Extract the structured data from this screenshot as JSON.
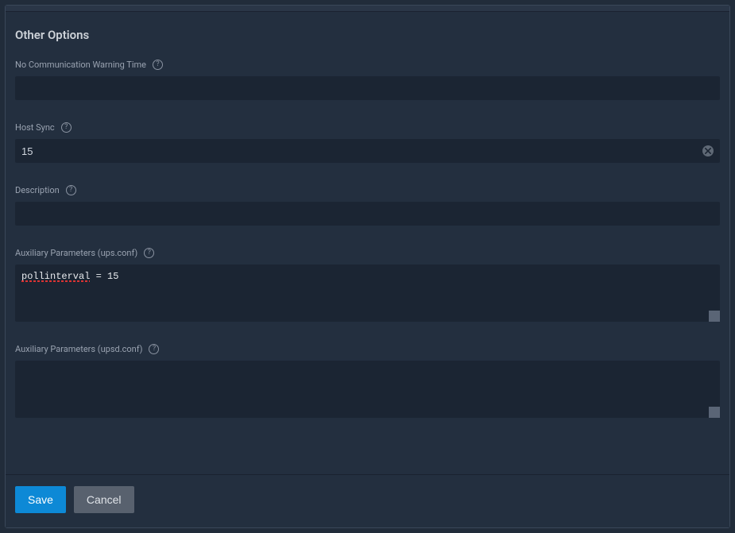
{
  "section": {
    "title": "Other Options"
  },
  "fields": {
    "nocomm": {
      "label": "No Communication Warning Time",
      "value": ""
    },
    "hostsync": {
      "label": "Host Sync",
      "value": "15"
    },
    "desc": {
      "label": "Description",
      "value": ""
    },
    "aux_ups": {
      "label": "Auxiliary Parameters (ups.conf)",
      "value": "pollinterval = 15"
    },
    "aux_upsd": {
      "label": "Auxiliary Parameters (upsd.conf)",
      "value": ""
    }
  },
  "buttons": {
    "save": "Save",
    "cancel": "Cancel"
  }
}
